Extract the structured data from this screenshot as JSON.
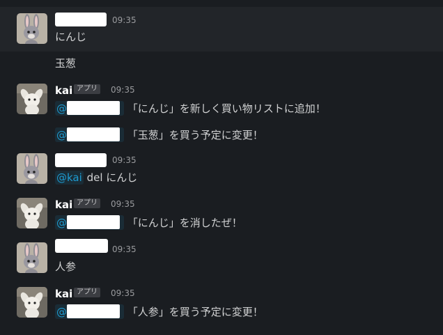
{
  "messages": [
    {
      "time": "09:35",
      "text": "にんじ"
    },
    {
      "text": "玉葱"
    },
    {
      "name": "kai",
      "badge": "アプリ",
      "time": "09:35",
      "at": "@",
      "text": "「にんじ」を新しく買い物リストに追加！"
    },
    {
      "at": "@",
      "text": "「玉葱」を買う予定に変更！"
    },
    {
      "time": "09:35",
      "mention": "@kai",
      "text": "del にんじ"
    },
    {
      "name": "kai",
      "badge": "アプリ",
      "time": "09:35",
      "at": "@",
      "text": "「にんじ」を消したぜ！"
    },
    {
      "time": "09:35",
      "text": "人参"
    },
    {
      "name": "kai",
      "badge": "アプリ",
      "time": "09:35",
      "at": "@",
      "text": "「人参」を買う予定に変更！"
    }
  ],
  "avatars": {
    "user": "bunny-plush-avatar",
    "bot": "white-plush-bot-avatar"
  },
  "colors": {
    "background": "#1a1d21",
    "hover_background": "#222529",
    "mention": "#1d9bd1",
    "badge_bg": "#3b3d42"
  }
}
